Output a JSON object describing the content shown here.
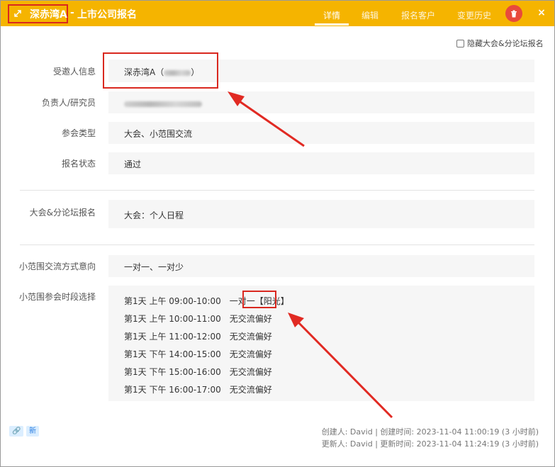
{
  "header": {
    "title": "深赤湾A",
    "separator": "-",
    "subtitle": "上市公司报名",
    "tabs": [
      {
        "label": "详情",
        "active": true
      },
      {
        "label": "编辑",
        "active": false
      },
      {
        "label": "报名客户",
        "active": false
      },
      {
        "label": "变更历史",
        "active": false
      }
    ],
    "delete_icon": "trash-icon",
    "close_icon": "×"
  },
  "options": {
    "hide_label": "隐藏大会&分论坛报名"
  },
  "fields": {
    "invitee_label": "受邀人信息",
    "invitee_value_prefix": "深赤湾A（",
    "invitee_value_suffix": "）",
    "owner_label": "负责人/研究员",
    "meeting_type_label": "参会类型",
    "meeting_type_value": "大会、小范围交流",
    "status_label": "报名状态",
    "status_value": "通过",
    "forum_label": "大会&分论坛报名",
    "forum_value": "大会：个人日程",
    "small_mode_label": "小范围交流方式意向",
    "small_mode_value": "一对一、一对少",
    "slots_label": "小范围参会时段选择"
  },
  "slots": [
    {
      "time": "第1天 上午 09:00-10:00",
      "pref": "一对一",
      "extra": "【阳光】"
    },
    {
      "time": "第1天 上午 10:00-11:00",
      "pref": "无交流偏好",
      "extra": ""
    },
    {
      "time": "第1天 上午 11:00-12:00",
      "pref": "无交流偏好",
      "extra": ""
    },
    {
      "time": "第1天 下午 14:00-15:00",
      "pref": "无交流偏好",
      "extra": ""
    },
    {
      "time": "第1天 下午 15:00-16:00",
      "pref": "无交流偏好",
      "extra": ""
    },
    {
      "time": "第1天 下午 16:00-17:00",
      "pref": "无交流偏好",
      "extra": ""
    }
  ],
  "footer": {
    "link_icon": "🔗",
    "new_badge": "新",
    "created": "创建人: David | 创建时间: 2023-11-04 11:00:19 (3 小时前)",
    "updated": "更新人: David | 更新时间: 2023-11-04 11:24:19 (3 小时前)"
  },
  "colors": {
    "header": "#f5b400",
    "annotation": "#d9281f",
    "delete": "#e84a3c",
    "field_bg": "#f6f6f6"
  }
}
